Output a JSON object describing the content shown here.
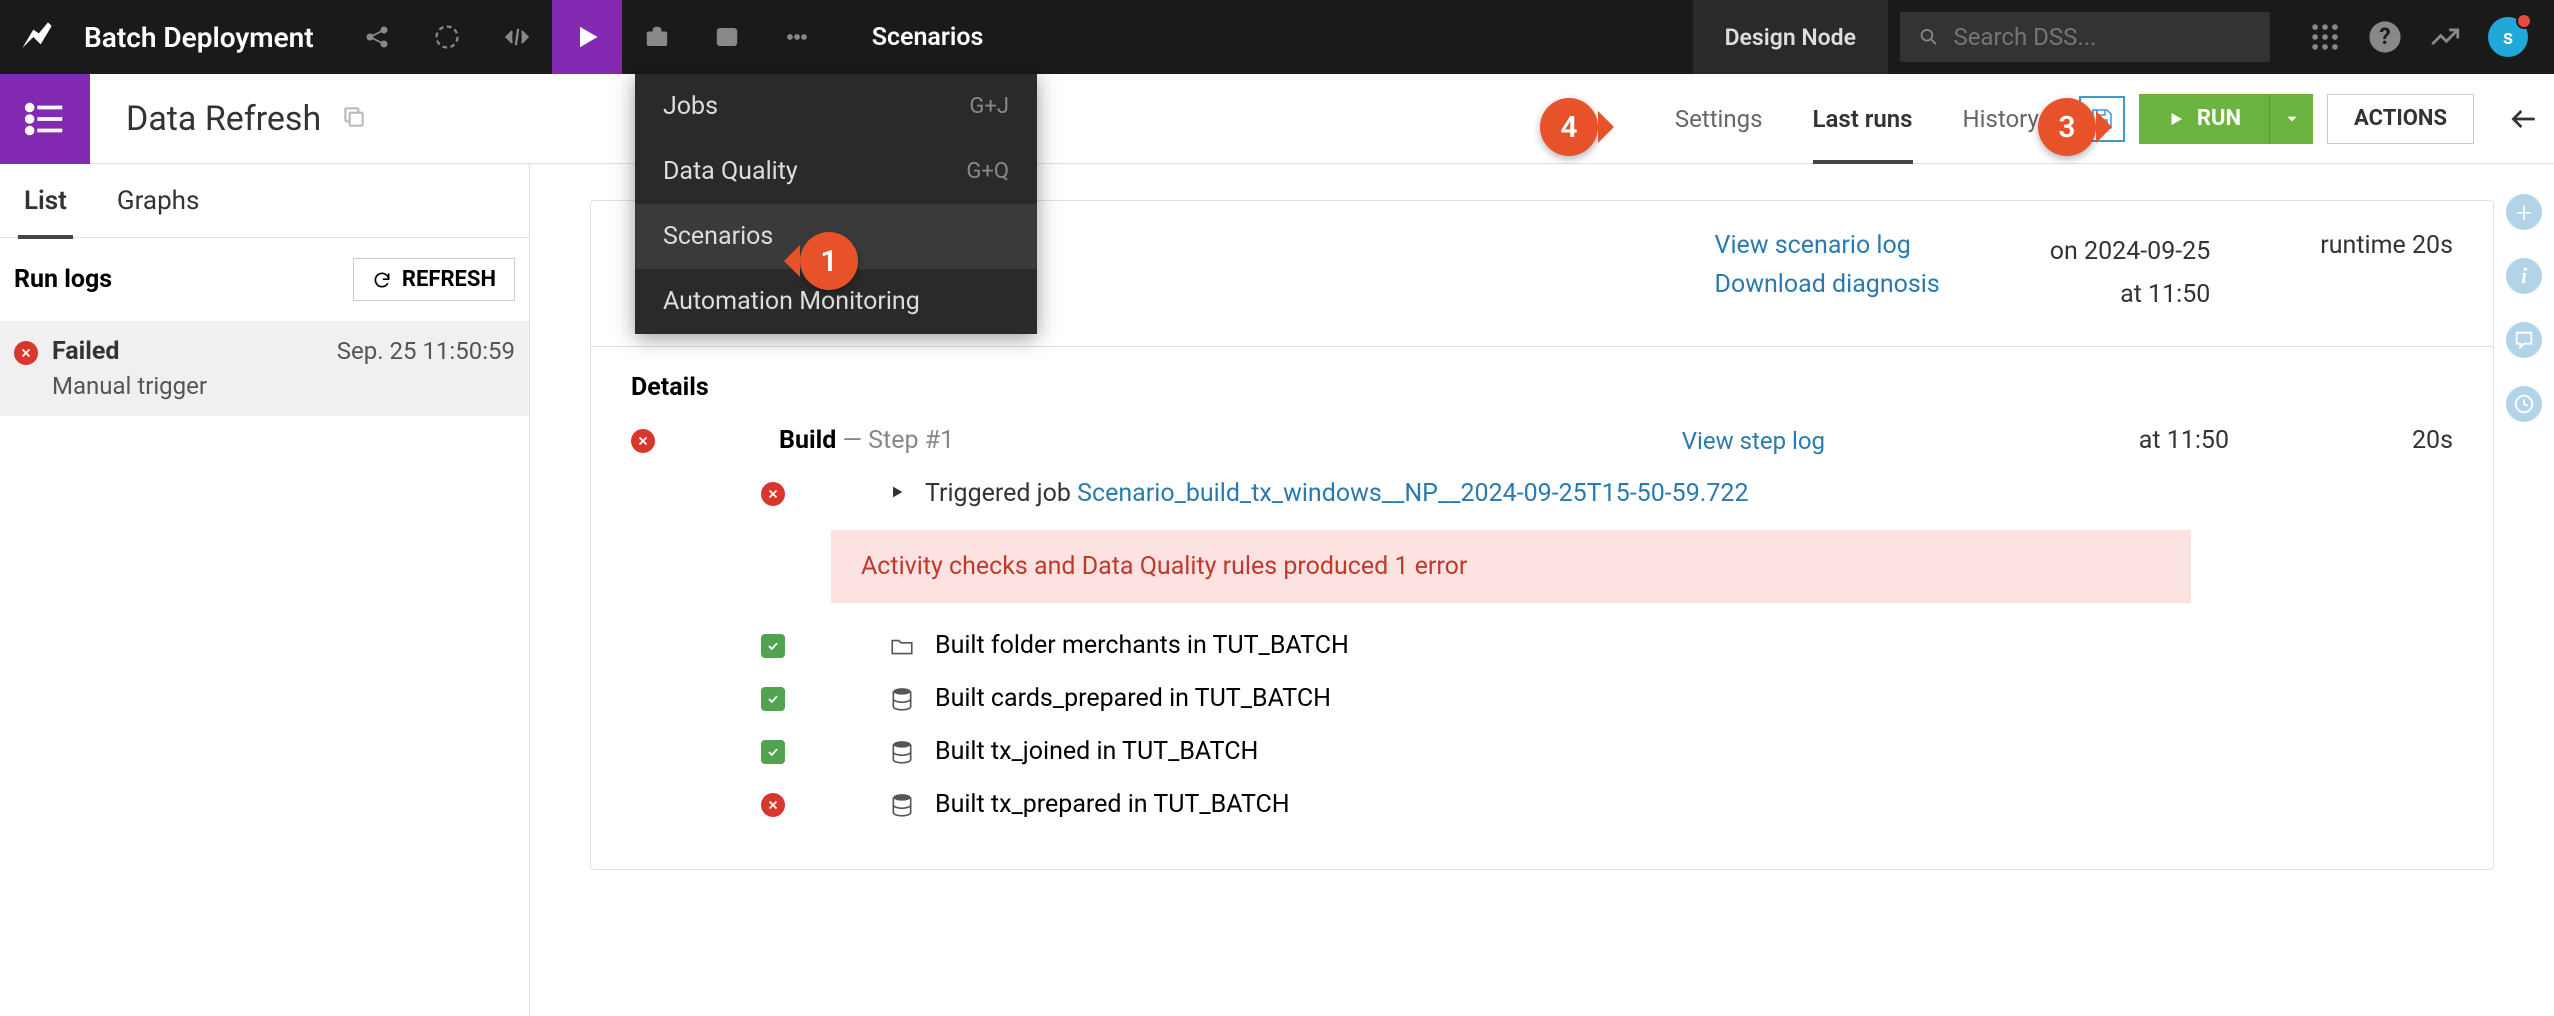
{
  "topbar": {
    "project_name": "Batch Deployment",
    "menu_title": "Scenarios",
    "design_node": "Design Node",
    "search_placeholder": "Search DSS...",
    "avatar_letter": "s"
  },
  "dropdown": {
    "items": [
      {
        "label": "Jobs",
        "shortcut": "G+J"
      },
      {
        "label": "Data Quality",
        "shortcut": "G+Q"
      },
      {
        "label": "Scenarios",
        "shortcut": ""
      },
      {
        "label": "Automation Monitoring",
        "shortcut": ""
      }
    ]
  },
  "subheader": {
    "page_title": "Data Refresh",
    "tabs": [
      "Settings",
      "Last runs",
      "History"
    ],
    "run_label": "RUN",
    "actions_label": "ACTIONS"
  },
  "sidebar": {
    "tabs": [
      "List",
      "Graphs"
    ],
    "runlogs_title": "Run logs",
    "refresh_label": "REFRESH",
    "log": {
      "status": "Failed",
      "trigger": "Manual trigger",
      "time": "Sep. 25 11:50:59"
    }
  },
  "run": {
    "link_log": "View scenario log",
    "link_diag": "Download diagnosis",
    "date": "on 2024-09-25",
    "time": "at 11:50",
    "runtime": "runtime 20s"
  },
  "details": {
    "title": "Details",
    "step_name": "Build",
    "step_sub": " — Step #1",
    "step_link": "View step log",
    "step_time": "at 11:50",
    "step_dur": "20s",
    "trigger_prefix": "Triggered job ",
    "trigger_link": "Scenario_build_tx_windows__NP__2024-09-25T15-50-59.722",
    "error_msg": "Activity checks and Data Quality rules produced 1 error",
    "builds": [
      {
        "status": "success",
        "icon": "folder",
        "text": "Built folder merchants in TUT_BATCH"
      },
      {
        "status": "success",
        "icon": "db",
        "text": "Built cards_prepared in TUT_BATCH"
      },
      {
        "status": "success",
        "icon": "db",
        "text": "Built tx_joined in TUT_BATCH"
      },
      {
        "status": "error",
        "icon": "db",
        "text": "Built tx_prepared in TUT_BATCH"
      }
    ]
  },
  "callouts": {
    "c1": "1",
    "c3": "3",
    "c4": "4"
  }
}
